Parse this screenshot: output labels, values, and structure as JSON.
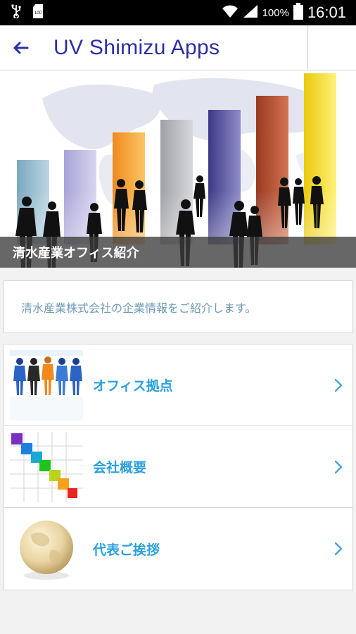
{
  "status_bar": {
    "battery": "100%",
    "time": "16:01"
  },
  "app_bar": {
    "title": "UV Shimizu Apps"
  },
  "hero": {
    "caption": "清水産業オフィス紹介"
  },
  "intro": {
    "text": "清水産業株式会社の企業情報をご紹介します。"
  },
  "menu": {
    "items": [
      {
        "label": "オフィス拠点",
        "icon": "people-icon"
      },
      {
        "label": "会社概要",
        "icon": "puzzle-icon"
      },
      {
        "label": "代表ご挨拶",
        "icon": "globe-icon"
      }
    ]
  },
  "colors": {
    "title": "#2b2ea8",
    "link": "#2aa0e0",
    "intro_text": "#6f9bb6"
  }
}
